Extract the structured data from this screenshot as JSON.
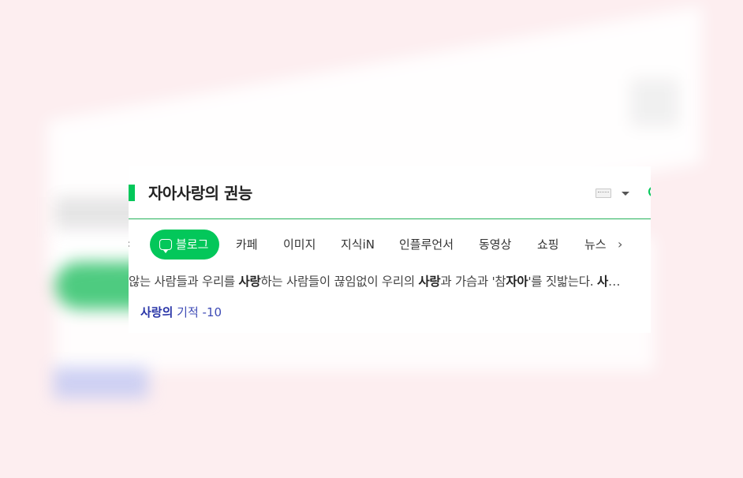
{
  "search": {
    "query": "자아사랑의 권능",
    "keyboard_icon": "keyboard-icon",
    "dropdown_icon": "caret-down-icon",
    "mic_icon": "mic-icon"
  },
  "tabs": [
    {
      "label": "블로그",
      "active": true,
      "icon": "blog-icon"
    },
    {
      "label": "카페"
    },
    {
      "label": "이미지"
    },
    {
      "label": "지식iN"
    },
    {
      "label": "인플루언서"
    },
    {
      "label": "동영상"
    },
    {
      "label": "쇼핑"
    },
    {
      "label": "뉴스"
    }
  ],
  "result": {
    "snippet_parts": [
      {
        "text": "않는 사람들과 우리를 ",
        "bold": false
      },
      {
        "text": "사랑",
        "bold": true
      },
      {
        "text": "하는 사람들이 끊임없이 우리의 ",
        "bold": false
      },
      {
        "text": "사랑",
        "bold": true
      },
      {
        "text": "과 가슴과 '참",
        "bold": false
      },
      {
        "text": "자아",
        "bold": true
      },
      {
        "text": "'를 짓밟는다. ",
        "bold": false
      },
      {
        "text": "사",
        "bold": true
      },
      {
        "text": "…",
        "bold": false
      }
    ],
    "source_bold": "사랑의",
    "source_rest": " 기적 -10"
  },
  "colors": {
    "accent": "#03c75a",
    "link": "#3d4ab5",
    "background": "#fdeef0"
  }
}
